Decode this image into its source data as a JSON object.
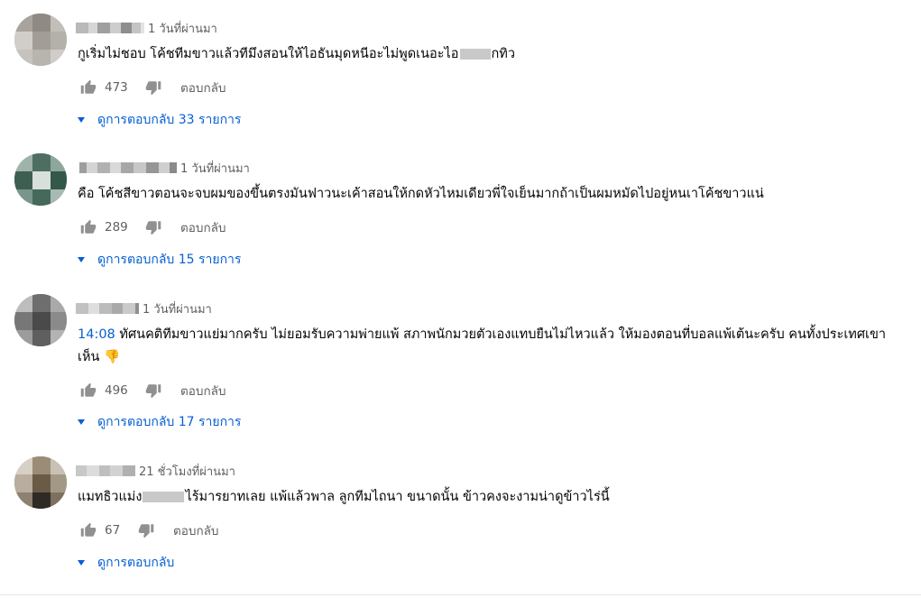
{
  "colors": {
    "link": "#065fd4",
    "meta": "#606060",
    "text": "#030303"
  },
  "comments": [
    {
      "time": "1 วันที่ผ่านมา",
      "text_before": "กูเริ่มไม่ชอบ โค้ชทีมขาวแล้วทีมึงสอนให้ไอธันมุดหนีอะไม่พูดเนอะไอ",
      "text_after": "กทิว",
      "likes": "473",
      "reply_label": "ตอบกลับ",
      "replies_label": "ดูการตอบกลับ 33 รายการ"
    },
    {
      "time": "1 วันที่ผ่านมา",
      "text": "คือ โค้ชสีขาวตอนจะจบผมของขึ้นตรงมันฟาวนะเค้าสอนให้กดหัวไหมเดียวพี่ใจเย็นมากถ้าเป็นผมหมัดไปอยู่หนเาโค้ชขาวแน่",
      "likes": "289",
      "reply_label": "ตอบกลับ",
      "replies_label": "ดูการตอบกลับ 15 รายการ"
    },
    {
      "time": "1 วันที่ผ่านมา",
      "timestamp_link": "14:08",
      "text": " ทัศนคติทีมขาวแย่มากครับ ไม่ยอมรับความพ่ายแพ้ สภาพนักมวยตัวเองแทบยืนไม่ไหวแล้ว ให้มองตอนที่บอลแพ้เต้นะครับ คนทั้งประเทศเขาเห็น ",
      "emoji": "👎",
      "likes": "496",
      "reply_label": "ตอบกลับ",
      "replies_label": "ดูการตอบกลับ 17 รายการ"
    },
    {
      "time": "21 ชั่วโมงที่ผ่านมา",
      "text_before": "แมทธิวแม่ง",
      "text_after": "ไร้มารยาทเลย แพ้แล้วพาล  ลูกทีมไถนา ขนาดนั้น ข้าวคงจะงามน่าดูข้าวไร่นี้",
      "likes": "67",
      "reply_label": "ตอบกลับ",
      "replies_label": "ดูการตอบกลับ"
    }
  ]
}
